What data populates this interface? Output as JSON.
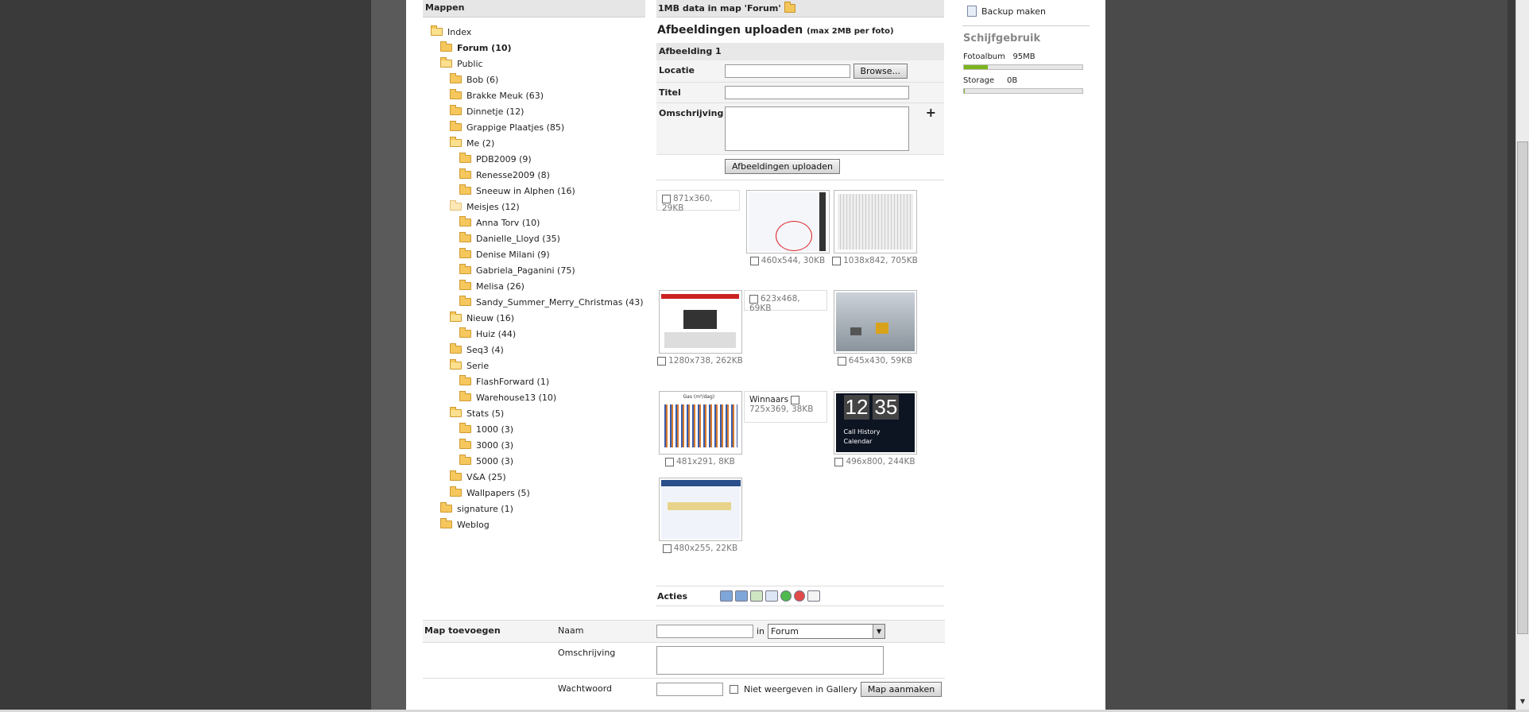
{
  "left": {
    "header": "Mappen",
    "tree": [
      {
        "label": "Index",
        "level": 0,
        "open": true
      },
      {
        "label": "Forum (10)",
        "level": 1,
        "open": false,
        "bold": true
      },
      {
        "label": "Public",
        "level": 1,
        "open": true
      },
      {
        "label": "Bob (6)",
        "level": 2
      },
      {
        "label": "Brakke Meuk (63)",
        "level": 2
      },
      {
        "label": "Dinnetje (12)",
        "level": 2
      },
      {
        "label": "Grappige Plaatjes (85)",
        "level": 2
      },
      {
        "label": "Me (2)",
        "level": 2,
        "open": true
      },
      {
        "label": "PDB2009 (9)",
        "level": 3
      },
      {
        "label": "Renesse2009 (8)",
        "level": 3
      },
      {
        "label": "Sneeuw in Alphen (16)",
        "level": 3
      },
      {
        "label": "Meisjes (12)",
        "level": 2,
        "open": true,
        "light": true
      },
      {
        "label": "Anna Torv (10)",
        "level": 3
      },
      {
        "label": "Danielle_Lloyd (35)",
        "level": 3
      },
      {
        "label": "Denise Milani (9)",
        "level": 3
      },
      {
        "label": "Gabriela_Paganini (75)",
        "level": 3
      },
      {
        "label": "Melisa (26)",
        "level": 3
      },
      {
        "label": "Sandy_Summer_Merry_Christmas (43)",
        "level": 3
      },
      {
        "label": "Nieuw (16)",
        "level": 2,
        "open": true
      },
      {
        "label": "Huiz (44)",
        "level": 3
      },
      {
        "label": "Seq3 (4)",
        "level": 2
      },
      {
        "label": "Serie",
        "level": 2,
        "open": true
      },
      {
        "label": "FlashForward (1)",
        "level": 3
      },
      {
        "label": "Warehouse13 (10)",
        "level": 3
      },
      {
        "label": "Stats (5)",
        "level": 2,
        "open": true
      },
      {
        "label": "1000 (3)",
        "level": 3
      },
      {
        "label": "3000 (3)",
        "level": 3
      },
      {
        "label": "5000 (3)",
        "level": 3
      },
      {
        "label": "V&A (25)",
        "level": 2
      },
      {
        "label": "Wallpapers (5)",
        "level": 2
      },
      {
        "label": "signature (1)",
        "level": 1
      },
      {
        "label": "Weblog",
        "level": 1
      }
    ]
  },
  "mid": {
    "header": "1MB data in map 'Forum'",
    "title": "Afbeeldingen uploaden",
    "title_note": "(max 2MB per foto)",
    "section": "Afbeelding 1",
    "locatie_label": "Locatie",
    "browse_label": "Browse...",
    "titel_label": "Titel",
    "omschrijving_label": "Omschrijving",
    "plus": "+",
    "upload_label": "Afbeeldingen uploaden",
    "thumbs": [
      {
        "label": "871x360, 29KB",
        "kind": "plain"
      },
      {
        "label": "460x544, 30KB",
        "kind": "img",
        "style": "screen"
      },
      {
        "label": "1038x842, 705KB",
        "kind": "img",
        "style": "grid"
      },
      {
        "label": "1280x738, 262KB",
        "kind": "img",
        "style": "web"
      },
      {
        "label": "623x468, 69KB",
        "kind": "plain"
      },
      {
        "label": "645x430, 59KB",
        "kind": "img",
        "style": "snow"
      },
      {
        "label": "481x291, 8KB",
        "kind": "img",
        "style": "chart"
      },
      {
        "label": "725x369, 38KB",
        "kind": "named",
        "name": "Winnaars"
      },
      {
        "label": "496x800, 244KB",
        "kind": "img",
        "style": "phone"
      },
      {
        "label": "480x255, 22KB",
        "kind": "img",
        "style": "map"
      }
    ],
    "phone_time_h": "12",
    "phone_time_m": "35",
    "phone_item1": "Call History",
    "phone_item2": "Calendar",
    "chart_caption": "Gas (m³/dag)",
    "acties_label": "Acties"
  },
  "addmap": {
    "title": "Map toevoegen",
    "naam_label": "Naam",
    "in_label": "in",
    "select_value": "Forum",
    "omschrijving_label": "Omschrijving",
    "wachtwoord_label": "Wachtwoord",
    "hidden_label": "Niet weergeven in Gallery",
    "submit_label": "Map aanmaken"
  },
  "right": {
    "backup_label": "Backup maken",
    "disk_title": "Schijfgebruik",
    "fotoalbum_label": "Fotoalbum",
    "fotoalbum_value": "95MB",
    "fotoalbum_fraction": 0.2,
    "storage_label": "Storage",
    "storage_value": "0B",
    "storage_fraction": 0.01
  },
  "colors": {
    "accent_green": "#7ab51d",
    "folder_yellow": "#f5c75c"
  }
}
